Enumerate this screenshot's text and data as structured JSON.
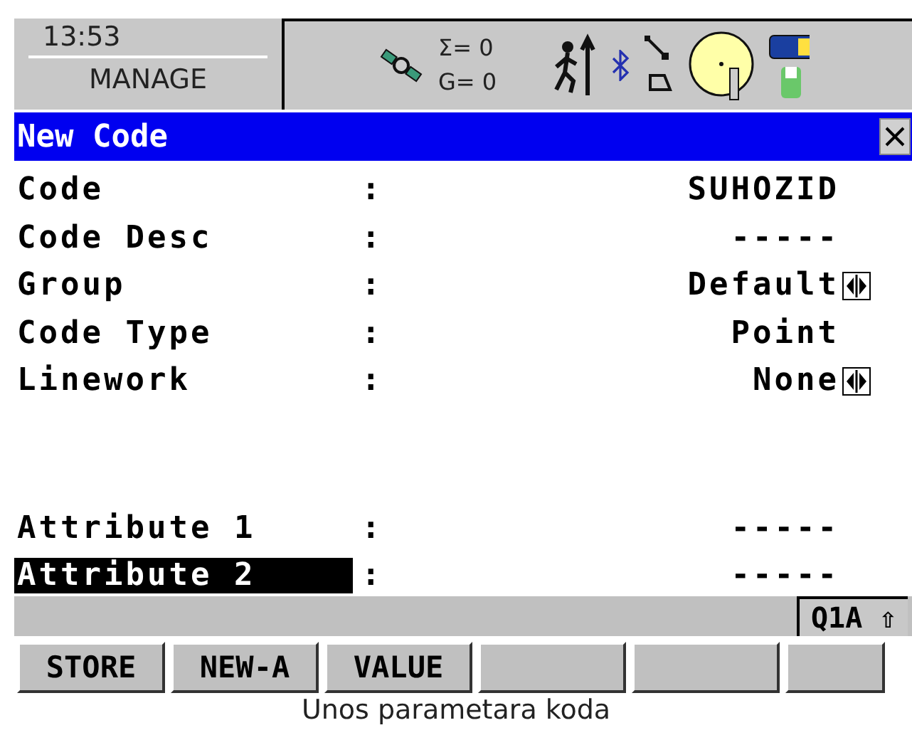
{
  "header": {
    "time": "13:53",
    "mode": "MANAGE",
    "satellites": {
      "sum": "Σ= 0",
      "glonass": "G= 0"
    }
  },
  "dialog": {
    "title": "New Code"
  },
  "fields": [
    {
      "label": "Code",
      "sep": ":",
      "value": "SUHOZID",
      "kind": "text",
      "selected": false
    },
    {
      "label": "Code Desc",
      "sep": ":",
      "value": "-----",
      "kind": "text",
      "selected": false
    },
    {
      "label": "Group",
      "sep": ":",
      "value": "Default",
      "kind": "choice",
      "selected": false
    },
    {
      "label": "Code Type",
      "sep": ":",
      "value": "Point",
      "kind": "text",
      "selected": false
    },
    {
      "label": "Linework",
      "sep": ":",
      "value": "None",
      "kind": "choice",
      "selected": false
    },
    {
      "kind": "spacer"
    },
    {
      "label": "Attribute 1",
      "sep": ":",
      "value": "-----",
      "kind": "text",
      "selected": false
    },
    {
      "label": "Attribute 2",
      "sep": ":",
      "value": "-----",
      "kind": "text",
      "selected": true
    }
  ],
  "status_bar": {
    "input_mode": "Q1A ⇧"
  },
  "softkeys": [
    {
      "kind": "label",
      "label": "STORE"
    },
    {
      "kind": "label",
      "label": "NEW-A"
    },
    {
      "kind": "label",
      "label": "VALUE"
    },
    {
      "kind": "blank"
    },
    {
      "kind": "blank"
    },
    {
      "kind": "blank"
    }
  ],
  "caption": "Unos parametara koda"
}
